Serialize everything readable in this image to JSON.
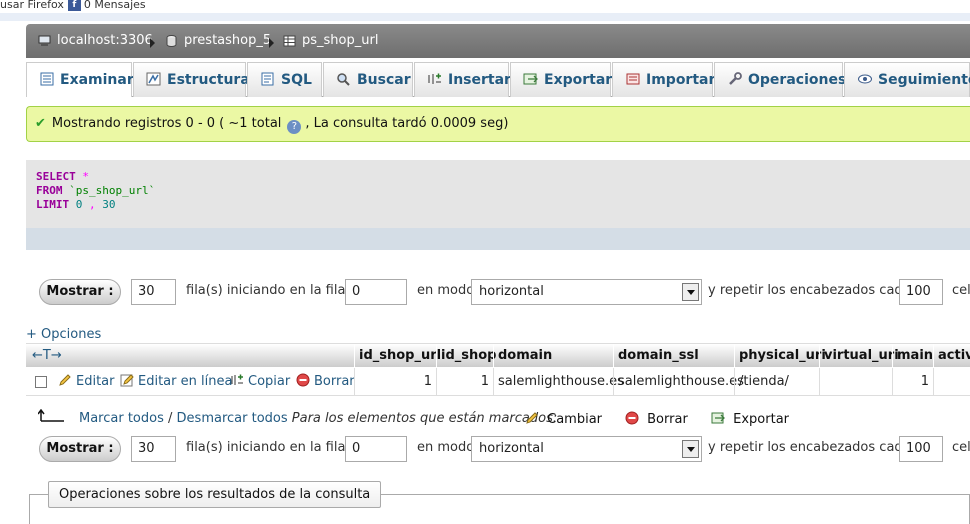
{
  "browser": {
    "top_text": "usar Firefox",
    "fb_badge": "f",
    "messages": "0 Mensajes"
  },
  "breadcrumb": {
    "server": "localhost:3306",
    "database": "prestashop_5",
    "table": "ps_shop_url"
  },
  "tabs": [
    {
      "label": "Examinar",
      "icon": "browse-icon"
    },
    {
      "label": "Estructura",
      "icon": "structure-icon"
    },
    {
      "label": "SQL",
      "icon": "sql-icon"
    },
    {
      "label": "Buscar",
      "icon": "search-icon"
    },
    {
      "label": "Insertar",
      "icon": "insert-icon"
    },
    {
      "label": "Exportar",
      "icon": "export-icon"
    },
    {
      "label": "Importar",
      "icon": "import-icon"
    },
    {
      "label": "Operaciones",
      "icon": "wrench-icon"
    },
    {
      "label": "Seguimiento",
      "icon": "eye-icon"
    }
  ],
  "message": {
    "prefix": "Mostrando registros 0 - 0 ( ~1 total",
    "help": "?",
    "suffix": ", La consulta tardó 0.0009 seg)"
  },
  "sql": {
    "select": "SELECT",
    "star": "*",
    "from": "FROM",
    "table": "`ps_shop_url`",
    "limit": "LIMIT",
    "offset": "0",
    "comma": ",",
    "count": "30"
  },
  "nav": {
    "show_button": "Mostrar :",
    "rows": "30",
    "rows_label": "fila(s) iniciando en la fila #",
    "start": "0",
    "mode_label": "en modo",
    "mode": "horizontal",
    "repeat_label": "y repetir los encabezados cada",
    "repeat": "100",
    "cells_label": "cel"
  },
  "options_link": "+ Opciones",
  "table": {
    "arrows": "←T→",
    "columns": [
      "id_shop_url",
      "id_shop",
      "domain",
      "domain_ssl",
      "physical_uri",
      "virtual_uri",
      "main",
      "activ"
    ],
    "actions": {
      "edit": "Editar",
      "inline_edit": "Editar en línea",
      "copy": "Copiar",
      "delete": "Borrar"
    },
    "rows": [
      {
        "id_shop_url": "1",
        "id_shop": "1",
        "domain": "salemlighthouse.es",
        "domain_ssl": "salemlighthouse.es",
        "physical_uri": "/tienda/",
        "virtual_uri": "",
        "main": "1",
        "active": ""
      }
    ]
  },
  "bulk": {
    "check_all": "Marcar todos",
    "slash": "/",
    "uncheck_all": "Desmarcar todos",
    "with_selected": "Para los elementos que están marcados:",
    "change": "Cambiar",
    "delete": "Borrar",
    "export": "Exportar"
  },
  "ops_legend": "Operaciones sobre los resultados de la consulta",
  "colors": {
    "breadcrumb_bg": "#7a7a7a",
    "tab_text": "#235a81",
    "success_bg": "#ebf8a4",
    "success_border": "#a2d246",
    "sql_bg": "#e5e5e5",
    "link": "#235a81"
  }
}
